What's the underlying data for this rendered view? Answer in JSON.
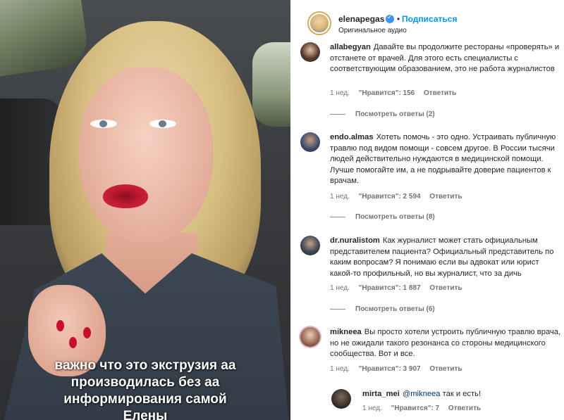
{
  "post": {
    "username": "elenapegas",
    "follow_label": "Подписаться",
    "separator": "•",
    "audio_label": "Оригинальное аудио"
  },
  "video": {
    "caption_lines": [
      "важно что это экструзия аа",
      "производилась без аа",
      "информирования самой",
      "Елены"
    ]
  },
  "comments": [
    {
      "username": "allabegyan",
      "text": "Давайте вы продолжите рестораны «проверять» и отстанете от врачей. Для этого есть специалисты с соответствующим образованием, это не работа журналистов",
      "time": "1 нед.",
      "likes": "\"Нравится\": 156",
      "reply_label": "Ответить",
      "view_replies": "Посмотреть ответы (2)"
    },
    {
      "username": "endo.almas",
      "text": "Хотеть помочь - это одно. Устраивать публичную травлю под видом помощи - совсем другое. В России тысячи людей действительно нуждаются в медицинской помощи. Лучше помогайте им, а не подрывайте доверие пациентов к врачам.",
      "time": "1 нед.",
      "likes": "\"Нравится\": 2 594",
      "reply_label": "Ответить",
      "view_replies": "Посмотреть ответы (8)"
    },
    {
      "username": "dr.nuralistom",
      "text": "Как журналист может стать официальным представителем пациента? Официальный представитель по каким вопросам? Я понимаю если вы адвокат или юрист какой-то профильный, но вы журналист, что за дичь",
      "time": "1 нед.",
      "likes": "\"Нравится\": 1 887",
      "reply_label": "Ответить",
      "view_replies": "Посмотреть ответы (6)"
    },
    {
      "username": "mikneea",
      "text": "Вы просто хотели устроить публичную травлю врача, но не ожидали такого резонанса со стороны медицинского сообщества. Вот и все.",
      "time": "1 нед.",
      "likes": "\"Нравится\": 3 907",
      "reply_label": "Ответить"
    }
  ],
  "reply": {
    "username": "mirta_mei",
    "mention": "@mikneea",
    "text": " так и есть!",
    "time": "1 нед.",
    "likes": "\"Нравится\": 7",
    "reply_label": "Ответить"
  },
  "colors": {
    "follow": "#0095f6",
    "verified": "#3897f0",
    "meta": "#737373"
  }
}
